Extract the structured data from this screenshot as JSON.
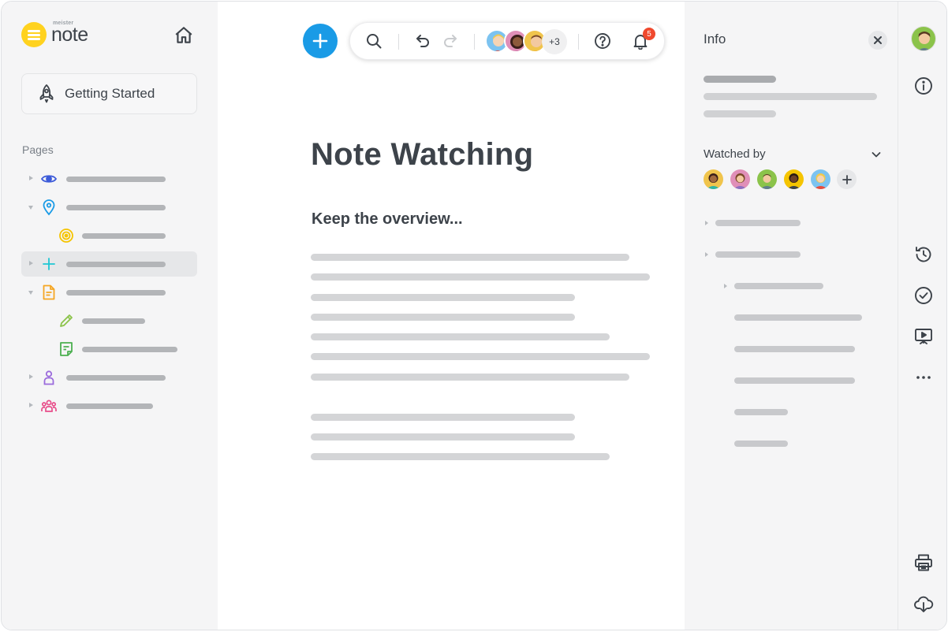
{
  "app": {
    "logo_small": "meister",
    "logo_big": "note",
    "brand_color": "#ffd21f",
    "accent_color": "#1a9be6"
  },
  "sidebar": {
    "getting_started_label": "Getting Started",
    "pages_label": "Pages",
    "pages": [
      {
        "icon": "eye-icon",
        "color": "#3d5bd9",
        "expanded": false,
        "selected": false
      },
      {
        "icon": "map-pin-icon",
        "color": "#1a9be6",
        "expanded": true,
        "selected": false
      },
      {
        "icon": "target-icon",
        "color": "#f5c400",
        "expanded": false,
        "selected": false,
        "child": true
      },
      {
        "icon": "plus-icon",
        "color": "#1fc7d4",
        "expanded": false,
        "selected": true
      },
      {
        "icon": "document-icon",
        "color": "#f5a623",
        "expanded": true,
        "selected": false
      },
      {
        "icon": "pencil-icon",
        "color": "#8bc34a",
        "expanded": false,
        "selected": false,
        "child": true
      },
      {
        "icon": "note-icon",
        "color": "#4caf50",
        "expanded": false,
        "selected": false,
        "child": true
      },
      {
        "icon": "person-icon",
        "color": "#9b6bdc",
        "expanded": false,
        "selected": false
      },
      {
        "icon": "group-icon",
        "color": "#e84e8a",
        "expanded": false,
        "selected": false
      }
    ]
  },
  "toolbar": {
    "icons": [
      "add-icon",
      "search-icon",
      "undo-icon",
      "redo-icon",
      "help-icon",
      "bell-icon"
    ],
    "extra_collaborators": "+3",
    "notification_count": "5"
  },
  "note": {
    "title": "Note Watching",
    "subtitle": "Keep the overview..."
  },
  "info_panel": {
    "title": "Info",
    "watched_by_label": "Watched by",
    "watcher_count": 5
  },
  "rail": {
    "icons": [
      "avatar",
      "info-icon",
      "history-icon",
      "check-circle-icon",
      "presentation-icon",
      "more-icon",
      "print-icon",
      "download-icon"
    ]
  },
  "notification_color": "#f0492e"
}
